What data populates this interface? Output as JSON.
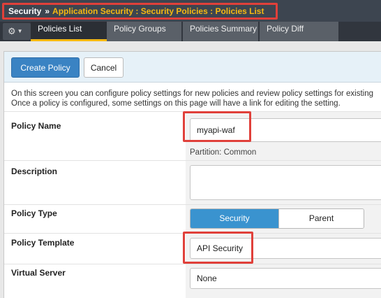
{
  "breadcrumb": {
    "root": "Security",
    "separator": "»",
    "path": "Application Security : Security Policies : Policies List"
  },
  "gear_menu": {
    "icon": "gear-icon",
    "caret": "▼"
  },
  "tabs": [
    {
      "label": "Policies List",
      "active": true
    },
    {
      "label": "Policy Groups",
      "active": false
    },
    {
      "label": "Policies Summary",
      "active": false
    },
    {
      "label": "Policy Diff",
      "active": false
    }
  ],
  "actions": {
    "create": "Create Policy",
    "cancel": "Cancel"
  },
  "intro": {
    "line1": "On this screen you can configure policy settings for new policies and review policy settings for existing",
    "line2": "Once a policy is configured, some settings on this page will have a link for editing the setting."
  },
  "form": {
    "policy_name": {
      "label": "Policy Name",
      "value": "myapi-waf",
      "partition": "Partition: Common"
    },
    "description": {
      "label": "Description",
      "value": ""
    },
    "policy_type": {
      "label": "Policy Type",
      "options": [
        "Security",
        "Parent"
      ],
      "selected": "Security"
    },
    "policy_template": {
      "label": "Policy Template",
      "value": "API Security"
    },
    "virtual_server": {
      "label": "Virtual Server",
      "value": "None"
    }
  },
  "colors": {
    "header_bg": "#3d4550",
    "breadcrumb_accent": "#f5b811",
    "highlight_box": "#e0403a",
    "primary_button": "#3a83c3",
    "segment_selected": "#3a93cf"
  }
}
